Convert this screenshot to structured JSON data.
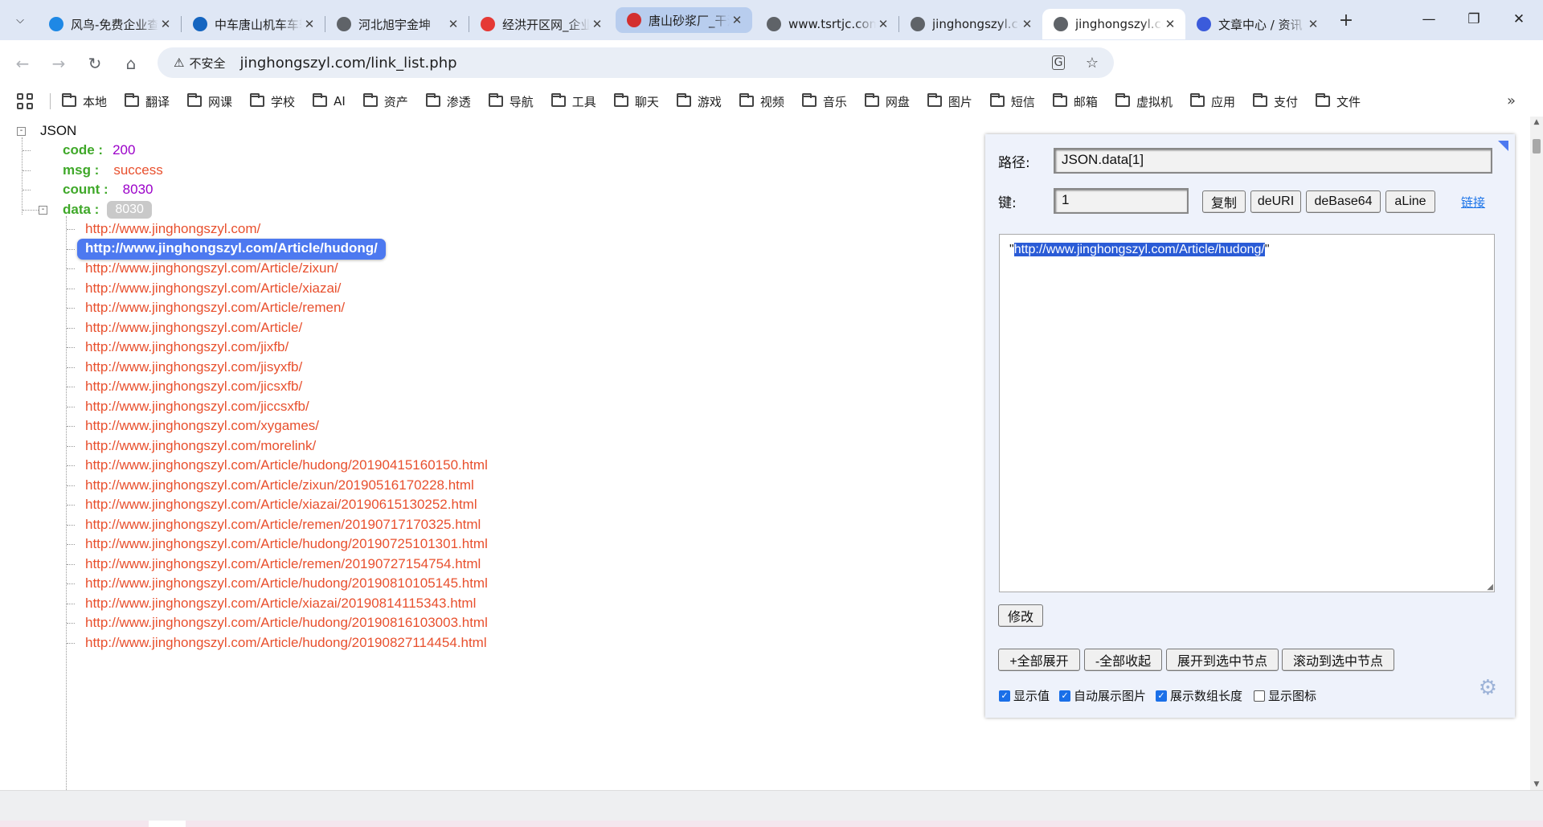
{
  "tabs": [
    {
      "title": "风鸟-免费企业查询",
      "fav_color": "#1e88e5",
      "fav_icon": "shield-blue"
    },
    {
      "title": "中车唐山机车车辆",
      "fav_color": "#1565c0",
      "fav_icon": "shield-check"
    },
    {
      "title": "河北旭宇金坤",
      "fav_color": "#5f6368",
      "fav_icon": "globe"
    },
    {
      "title": "经洪开区网_企业",
      "fav_color": "#e53935",
      "fav_icon": "h-logo"
    },
    {
      "title": "唐山砂浆厂_干混",
      "fav_color": "#d32f2f",
      "fav_icon": "red-square"
    },
    {
      "title": "www.tsrtjc.com",
      "fav_color": "#5f6368",
      "fav_icon": "globe"
    },
    {
      "title": "jinghongszyl.com",
      "fav_color": "#5f6368",
      "fav_icon": "globe"
    },
    {
      "title": "jinghongszyl.com",
      "fav_color": "#5f6368",
      "fav_icon": "globe"
    },
    {
      "title": "文章中心 / 资讯",
      "fav_color": "#3b5bdb",
      "fav_icon": "c-logo"
    }
  ],
  "address": {
    "secure_label": "不安全",
    "url": "jinghongszyl.com/link_list.php"
  },
  "bookmarks": [
    "本地",
    "翻译",
    "网课",
    "学校",
    "AI",
    "资产",
    "渗透",
    "导航",
    "工具",
    "聊天",
    "游戏",
    "视频",
    "音乐",
    "网盘",
    "图片",
    "短信",
    "邮箱",
    "虚拟机",
    "应用",
    "支付",
    "文件"
  ],
  "tree": {
    "root": "JSON",
    "code_key": "code :",
    "code_val": "200",
    "msg_key": "msg :",
    "msg_val": "success",
    "count_key": "count :",
    "count_val": "8030",
    "data_key": "data :",
    "data_len": "8030",
    "items": [
      "http://www.jinghongszyl.com/",
      "http://www.jinghongszyl.com/Article/hudong/",
      "http://www.jinghongszyl.com/Article/zixun/",
      "http://www.jinghongszyl.com/Article/xiazai/",
      "http://www.jinghongszyl.com/Article/remen/",
      "http://www.jinghongszyl.com/Article/",
      "http://www.jinghongszyl.com/jixfb/",
      "http://www.jinghongszyl.com/jisyxfb/",
      "http://www.jinghongszyl.com/jicsxfb/",
      "http://www.jinghongszyl.com/jiccsxfb/",
      "http://www.jinghongszyl.com/xygames/",
      "http://www.jinghongszyl.com/morelink/",
      "http://www.jinghongszyl.com/Article/hudong/20190415160150.html",
      "http://www.jinghongszyl.com/Article/zixun/20190516170228.html",
      "http://www.jinghongszyl.com/Article/xiazai/20190615130252.html",
      "http://www.jinghongszyl.com/Article/remen/20190717170325.html",
      "http://www.jinghongszyl.com/Article/hudong/20190725101301.html",
      "http://www.jinghongszyl.com/Article/remen/20190727154754.html",
      "http://www.jinghongszyl.com/Article/hudong/20190810105145.html",
      "http://www.jinghongszyl.com/Article/xiazai/20190814115343.html",
      "http://www.jinghongszyl.com/Article/hudong/20190816103003.html",
      "http://www.jinghongszyl.com/Article/hudong/20190827114454.html"
    ],
    "selected_index": 1
  },
  "panel": {
    "path_label": "路径:",
    "path_value": "JSON.data[1]",
    "key_label": "键:",
    "key_value": "1",
    "copy_btn": "复制",
    "deuri_btn": "deURI",
    "debase64_btn": "deBase64",
    "aline_btn": "aLine",
    "link_text": "链接",
    "value_quote_open": "\"",
    "value_text": "http://www.jinghongszyl.com/Article/hudong/",
    "value_quote_close": "\"",
    "modify_btn": "修改",
    "expand_all_btn": "+全部展开",
    "collapse_all_btn": "-全部收起",
    "expand_to_sel_btn": "展开到选中节点",
    "scroll_to_sel_btn": "滚动到选中节点",
    "cb_show_value": "显示值",
    "cb_auto_image": "自动展示图片",
    "cb_array_len": "展示数组长度",
    "cb_show_icon": "显示图标",
    "cb_states": [
      true,
      true,
      true,
      false
    ]
  },
  "colors": {
    "key": "#3fa829",
    "number": "#9b00c9",
    "string": "#e8502e",
    "selected": "#4d79f0"
  }
}
